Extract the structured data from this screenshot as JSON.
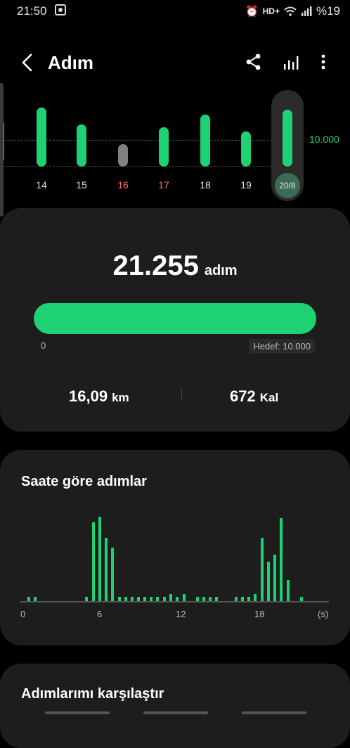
{
  "status_bar": {
    "time": "21:50",
    "network": "HD+",
    "battery": "%19"
  },
  "app_bar": {
    "title": "Adım",
    "icons": [
      "back-chevron-icon",
      "share-icon",
      "bar-chart-icon",
      "more-vert-icon"
    ]
  },
  "weekly": {
    "goal_label": "10.000",
    "edge_day": "3",
    "days": [
      {
        "label": "14",
        "weekend": false,
        "below_goal": false
      },
      {
        "label": "15",
        "weekend": false,
        "below_goal": false
      },
      {
        "label": "16",
        "weekend": true,
        "below_goal": true
      },
      {
        "label": "17",
        "weekend": true,
        "below_goal": false
      },
      {
        "label": "18",
        "weekend": false,
        "below_goal": false
      },
      {
        "label": "19",
        "weekend": false,
        "below_goal": false
      }
    ],
    "selected_day": "20/8",
    "colors": {
      "accent": "#1ed273",
      "below_goal": "#808080",
      "weekend_label": "#ff6b6b"
    }
  },
  "summary": {
    "steps": "21.255",
    "steps_unit": "adım",
    "progress_fraction": 1.0,
    "progress_min": "0",
    "goal_text": "Hedef: 10.000",
    "distance": "16,09",
    "distance_unit": "km",
    "calories": "672",
    "calories_unit": "Kal"
  },
  "hourly": {
    "title": "Saate göre adımlar",
    "ticks": [
      "0",
      "6",
      "12",
      "18",
      "(s)"
    ]
  },
  "compare": {
    "title": "Adımlarımı karşılaştır"
  }
}
